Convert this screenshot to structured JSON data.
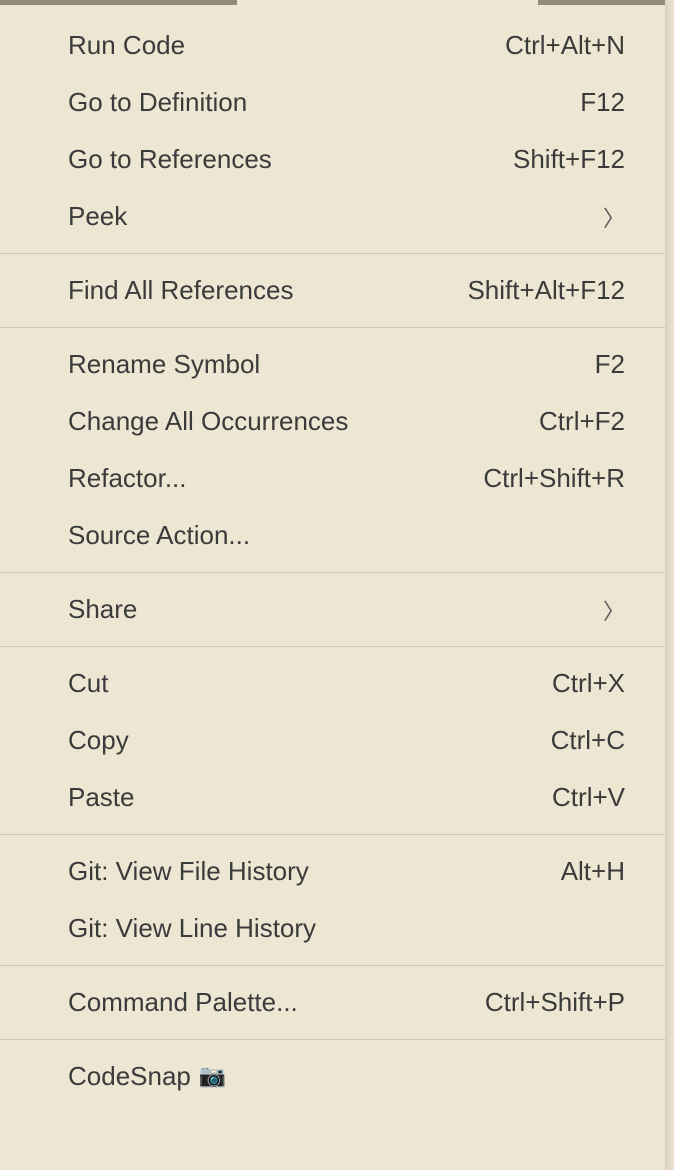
{
  "menu": {
    "groups": [
      {
        "items": [
          {
            "label": "Run Code",
            "shortcut": "Ctrl+Alt+N",
            "name": "run-code"
          },
          {
            "label": "Go to Definition",
            "shortcut": "F12",
            "name": "go-to-definition"
          },
          {
            "label": "Go to References",
            "shortcut": "Shift+F12",
            "name": "go-to-references"
          },
          {
            "label": "Peek",
            "submenu": true,
            "name": "peek"
          }
        ]
      },
      {
        "items": [
          {
            "label": "Find All References",
            "shortcut": "Shift+Alt+F12",
            "name": "find-all-references"
          }
        ]
      },
      {
        "items": [
          {
            "label": "Rename Symbol",
            "shortcut": "F2",
            "name": "rename-symbol"
          },
          {
            "label": "Change All Occurrences",
            "shortcut": "Ctrl+F2",
            "name": "change-all-occurrences"
          },
          {
            "label": "Refactor...",
            "shortcut": "Ctrl+Shift+R",
            "name": "refactor"
          },
          {
            "label": "Source Action...",
            "name": "source-action"
          }
        ]
      },
      {
        "items": [
          {
            "label": "Share",
            "submenu": true,
            "name": "share"
          }
        ]
      },
      {
        "items": [
          {
            "label": "Cut",
            "shortcut": "Ctrl+X",
            "name": "cut"
          },
          {
            "label": "Copy",
            "shortcut": "Ctrl+C",
            "name": "copy"
          },
          {
            "label": "Paste",
            "shortcut": "Ctrl+V",
            "name": "paste"
          }
        ]
      },
      {
        "items": [
          {
            "label": "Git: View File History",
            "shortcut": "Alt+H",
            "name": "git-view-file-history"
          },
          {
            "label": "Git: View Line History",
            "name": "git-view-line-history"
          }
        ]
      },
      {
        "items": [
          {
            "label": "Command Palette...",
            "shortcut": "Ctrl+Shift+P",
            "name": "command-palette"
          }
        ]
      },
      {
        "items": [
          {
            "label": "CodeSnap",
            "icon": "camera",
            "name": "codesnap"
          }
        ]
      }
    ]
  }
}
